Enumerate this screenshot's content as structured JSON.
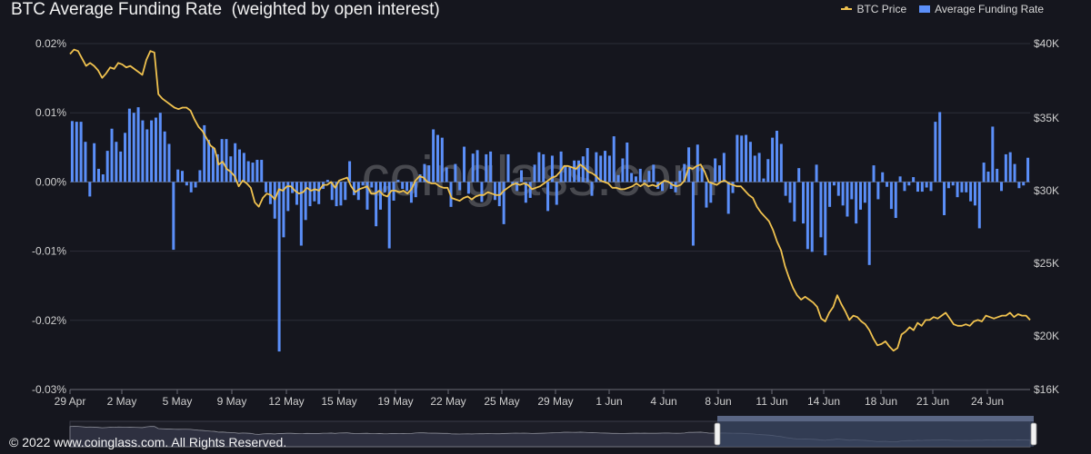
{
  "title": "BTC Average Funding Rate  (weighted by open interest)",
  "legend": {
    "price_label": "BTC Price",
    "funding_label": "Average Funding Rate"
  },
  "watermark": "coinglass.com",
  "copyright": "© 2022 www.coinglass.com. All Rights Reserved.",
  "colors": {
    "background": "#15161e",
    "funding_bar": "#5b8ff9",
    "price_line": "#f0c24f",
    "navigator_fill": "#3a4763"
  },
  "chart_data": {
    "type": "bar",
    "x_tick_labels": [
      "29 Apr",
      "2 May",
      "5 May",
      "9 May",
      "12 May",
      "15 May",
      "19 May",
      "22 May",
      "25 May",
      "29 May",
      "1 Jun",
      "4 Jun",
      "8 Jun",
      "11 Jun",
      "14 Jun",
      "18 Jun",
      "21 Jun",
      "24 Jun"
    ],
    "left_axis": {
      "tick_labels": [
        "0.02%",
        "0.01%",
        "0.00%",
        "-0.01%",
        "-0.02%",
        "-0.03%"
      ],
      "ylim": [
        -0.03,
        0.02
      ],
      "unit": "%"
    },
    "right_axis": {
      "tick_labels": [
        "$40K",
        "$35K",
        "$30K",
        "$25K",
        "$20K",
        "$16K"
      ],
      "ylim": [
        16000,
        40000
      ]
    },
    "grid": true,
    "legend_position": "top-right",
    "series": [
      {
        "name": "Average Funding Rate",
        "kind": "bar",
        "axis": "left",
        "values": [
          0.0088,
          0.0087,
          0.0087,
          0.0058,
          -0.0021,
          0.0056,
          0.0019,
          0.0011,
          0.0045,
          0.0077,
          0.0058,
          0.0044,
          0.0071,
          0.0106,
          0.01,
          0.0108,
          0.0089,
          0.0076,
          0.0089,
          0.0093,
          0.01,
          0.0073,
          0.0055,
          -0.0098,
          0.0018,
          0.0016,
          -0.0005,
          -0.0015,
          -0.0008,
          0.0017,
          0.0082,
          0.0061,
          0.005,
          0.004,
          0.0062,
          0.0062,
          0.0037,
          0.0056,
          0.0047,
          0.0042,
          0.003,
          0.0028,
          0.0032,
          0.0032,
          -0.0015,
          -0.0032,
          -0.0053,
          -0.0245,
          -0.008,
          -0.0042,
          -0.0016,
          -0.0033,
          -0.0092,
          -0.0055,
          -0.0035,
          -0.0028,
          -0.0032,
          -0.001,
          0.0003,
          -0.0026,
          -0.0035,
          -0.0034,
          -0.0026,
          0.003,
          -0.0019,
          -0.0026,
          -0.0005,
          -0.004,
          -0.0008,
          -0.0064,
          -0.004,
          -0.0015,
          -0.0096,
          -0.0027,
          0.0003,
          -0.001,
          -0.0013,
          -0.003,
          -0.0022,
          0.0011,
          0.0026,
          0.0024,
          0.0076,
          0.0068,
          0.0064,
          0.0021,
          -0.0036,
          0.0026,
          -0.0012,
          0.0051,
          -0.0017,
          0.0041,
          0.0046,
          -0.0029,
          0.004,
          0.0044,
          -0.0026,
          -0.0035,
          -0.0061,
          0.004,
          -0.0004,
          -0.0013,
          0.0017,
          -0.003,
          -0.0023,
          0.0025,
          0.0043,
          0.004,
          -0.0042,
          0.0038,
          -0.0033,
          0.0044,
          0.0023,
          0.0022,
          0.0031,
          0.0031,
          0.0037,
          0.0049,
          -0.002,
          0.0043,
          0.0038,
          0.0045,
          0.0038,
          0.0066,
          0.001,
          0.0034,
          0.0057,
          0.0013,
          0.0008,
          0.0019,
          0.0003,
          0.0016,
          0.0025,
          -0.001,
          -0.0013,
          0.0001,
          -0.001,
          -0.0015,
          0.0016,
          0.0026,
          0.005,
          -0.0092,
          0.0054,
          0.002,
          -0.0037,
          -0.003,
          0.0034,
          0.0024,
          0.0042,
          -0.0046,
          -0.0016,
          0.0068,
          0.0067,
          0.0068,
          0.0058,
          0.0038,
          0.0042,
          0.0005,
          0.0033,
          0.0064,
          0.0074,
          0.0055,
          -0.002,
          -0.003,
          -0.0057,
          0.002,
          -0.006,
          -0.0097,
          -0.0101,
          0.0025,
          -0.008,
          -0.0106,
          -0.0036,
          -0.0005,
          -0.002,
          -0.0034,
          -0.005,
          -0.0025,
          -0.006,
          -0.004,
          -0.003,
          -0.012,
          0.0024,
          -0.0025,
          0.0014,
          -0.0007,
          -0.0039,
          -0.0052,
          0.0008,
          -0.0013,
          -0.0005,
          0.0007,
          -0.0014,
          -0.0014,
          -0.0008,
          -0.0013,
          0.0087,
          0.0101,
          -0.0048,
          -0.0009,
          -0.0005,
          -0.0022,
          -0.0015,
          -0.0015,
          -0.0028,
          -0.0034,
          -0.0067,
          0.0028,
          0.0015,
          0.008,
          0.0019,
          -0.0013,
          0.004,
          0.0043,
          0.0026,
          -0.0009,
          -0.0005,
          0.0035
        ]
      },
      {
        "name": "BTC Price",
        "kind": "line",
        "axis": "right",
        "values": [
          39300,
          39600,
          39500,
          39000,
          38500,
          38700,
          38500,
          38200,
          37700,
          38000,
          38400,
          38300,
          38700,
          38600,
          38400,
          38500,
          38300,
          38100,
          37900,
          38900,
          39500,
          39400,
          36600,
          36300,
          36100,
          35900,
          35700,
          35600,
          35700,
          35700,
          35500,
          34900,
          34400,
          34100,
          33600,
          33100,
          32900,
          31800,
          32000,
          31500,
          31300,
          31000,
          30300,
          30700,
          30500,
          30200,
          29200,
          28900,
          29500,
          29800,
          29700,
          29400,
          30100,
          30000,
          30300,
          30300,
          30000,
          29800,
          29900,
          30200,
          30000,
          30100,
          30000,
          30400,
          30400,
          30600,
          30200,
          30700,
          30800,
          30900,
          30300,
          29900,
          30100,
          30200,
          30300,
          29800,
          29800,
          30000,
          29700,
          29600,
          30000,
          30000,
          29900,
          30000,
          29800,
          30100,
          30700,
          31000,
          30900,
          30600,
          30500,
          30500,
          30300,
          30200,
          30200,
          29500,
          29400,
          29300,
          29500,
          29600,
          29400,
          29600,
          29700,
          29700,
          29900,
          29800,
          29700,
          29700,
          30000,
          30200,
          30400,
          30500,
          30400,
          30500,
          30400,
          30100,
          30200,
          30300,
          30500,
          30700,
          30900,
          31000,
          31300,
          31700,
          31700,
          31600,
          31500,
          31800,
          31600,
          31300,
          31200,
          31000,
          30700,
          30600,
          30500,
          30200,
          30200,
          30100,
          30100,
          30200,
          30300,
          30500,
          30300,
          30500,
          30300,
          30400,
          30300,
          30500,
          30700,
          30600,
          30400,
          30300,
          30400,
          30700,
          31600,
          31500,
          31700,
          31800,
          31300,
          30600,
          30500,
          30400,
          30600,
          30700,
          30500,
          30400,
          30300,
          30300,
          30000,
          29700,
          29500,
          28900,
          28500,
          28200,
          27900,
          27300,
          26500,
          25900,
          24800,
          24000,
          23300,
          22800,
          22500,
          22700,
          22500,
          22300,
          22000,
          21200,
          21000,
          21600,
          22000,
          22800,
          22200,
          21700,
          21100,
          21400,
          21300,
          21000,
          20800,
          20400,
          19800,
          19300,
          19400,
          19600,
          19200,
          18900,
          19100,
          20100,
          20300,
          20600,
          20400,
          20900,
          20700,
          21100,
          21100,
          21300,
          21200,
          21400,
          21600,
          21200,
          20800,
          20700,
          20700,
          20800,
          20700,
          21000,
          21100,
          21000,
          21400,
          21300,
          21200,
          21300,
          21400,
          21400,
          21600,
          21300,
          21500,
          21400,
          21400,
          21100
        ]
      }
    ]
  }
}
